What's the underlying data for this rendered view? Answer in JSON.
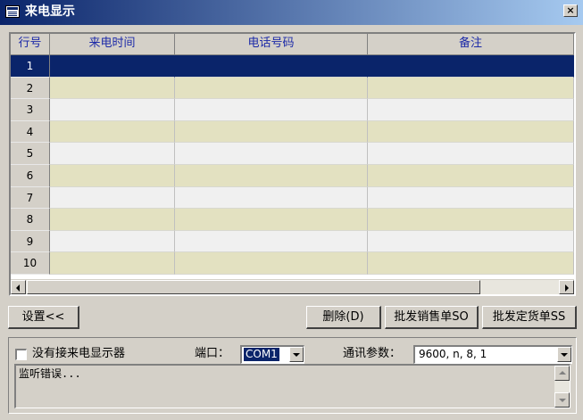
{
  "window": {
    "title": "来电显示",
    "close_label": "×"
  },
  "table": {
    "columns": [
      "行号",
      "来电时间",
      "电话号码",
      "备注"
    ],
    "rows": [
      "1",
      "2",
      "3",
      "4",
      "5",
      "6",
      "7",
      "8",
      "9",
      "10"
    ],
    "selected_row": "1"
  },
  "buttons": {
    "settings": "设置<<",
    "delete": "删除(D)",
    "wholesale_sales": "批发销售单SO",
    "wholesale_order": "批发定货单SS"
  },
  "settings": {
    "no_display_label": "没有接来电显示器",
    "no_display_checked": false,
    "port_label": "端口：",
    "port_value": "COM1",
    "comm_label": "通讯参数：",
    "comm_value": "9600, n, 8, 1",
    "log_text": "监听错误..."
  },
  "colors": {
    "selection": "#0a246a",
    "row_alt": "#e3e1c1",
    "header_text": "#1c2aa8"
  }
}
